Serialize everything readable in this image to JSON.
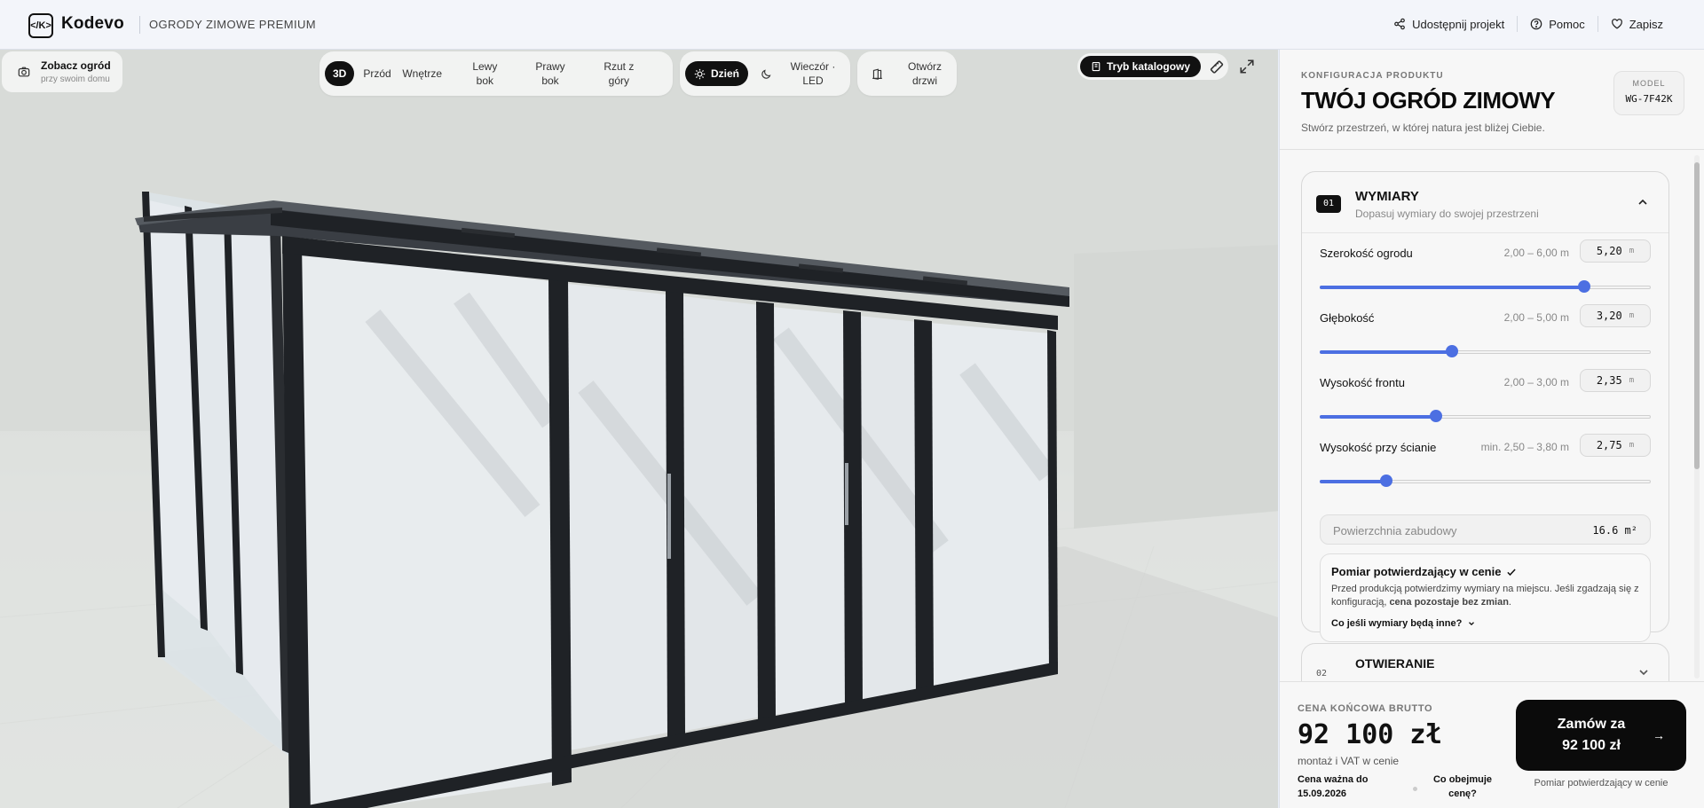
{
  "header": {
    "logo": "</K>",
    "brand": "Kodevo",
    "section": "OGRODY ZIMOWE PREMIUM",
    "actions": [
      {
        "label": "Udostępnij projekt",
        "icon": "share-icon"
      },
      {
        "label": "Pomoc",
        "icon": "help-icon"
      },
      {
        "label": "Zapisz",
        "icon": "heart-icon"
      }
    ]
  },
  "viewport": {
    "see_garden": {
      "title": "Zobacz ogród",
      "subtitle": "przy swoim domu"
    },
    "views": [
      "3D",
      "Przód",
      "Wnętrze",
      "Lewy bok",
      "Prawy bok",
      "Rzut z góry"
    ],
    "active_view": "3D",
    "lighting": [
      "Dzień",
      "Wieczór · LED"
    ],
    "active_lighting": "Dzień",
    "door_toggle": "Otwórz drzwi",
    "catalog_mode": "Tryb katalogowy"
  },
  "panel": {
    "eyebrow": "KONFIGURACJA PRODUKTU",
    "title": "TWÓJ OGRÓD ZIMOWY",
    "subtitle": "Stwórz przestrzeń, w której natura jest bliżej Ciebie.",
    "model_label": "MODEL",
    "model_value": "WG-7F42K",
    "section1": {
      "number": "01",
      "title": "WYMIARY",
      "subtitle": "Dopasuj wymiary do swojej przestrzeni",
      "dimensions": [
        {
          "label": "Szerokość ogrodu",
          "range": "2,00 – 6,00 m",
          "value": "5,20",
          "unit": "m",
          "fraction": 0.8
        },
        {
          "label": "Głębokość",
          "range": "2,00 – 5,00 m",
          "value": "3,20",
          "unit": "m",
          "fraction": 0.4
        },
        {
          "label": "Wysokość frontu",
          "range": "2,00 – 3,00 m",
          "value": "2,35",
          "unit": "m",
          "fraction": 0.35
        },
        {
          "label": "Wysokość przy ścianie",
          "range": "min. 2,50 – 3,80 m",
          "value": "2,75",
          "unit": "m",
          "fraction": 0.2
        }
      ],
      "area_label": "Powierzchnia zabudowy",
      "area_value": "16.6 m²",
      "note_title": "Pomiar potwierdzający w cenie",
      "note_body_1": "Przed produkcją potwierdzimy wymiary na miejscu. Jeśli zgadzają się z konfiguracją, ",
      "note_body_bold": "cena pozostaje bez zmian",
      "note_body_2": ".",
      "note_link": "Co jeśli wymiary będą inne?"
    },
    "section2": {
      "number": "02",
      "title": "OTWIERANIE"
    },
    "footer": {
      "price_label": "CENA KOŃCOWA BRUTTO",
      "price": "92 100 zł",
      "price_sub": "montaż i VAT w cenie",
      "valid_label": "Cena ważna do",
      "valid_date": "15.09.2026",
      "whats_included": "Co obejmuje cenę?",
      "order_line1": "Zamów za",
      "order_line2": "92 100 zł",
      "order_note": "Pomiar potwierdzający w cenie"
    }
  },
  "colors": {
    "accent": "#4c6fe2",
    "dark": "#0b0b0b",
    "frame": "#1f2226"
  }
}
